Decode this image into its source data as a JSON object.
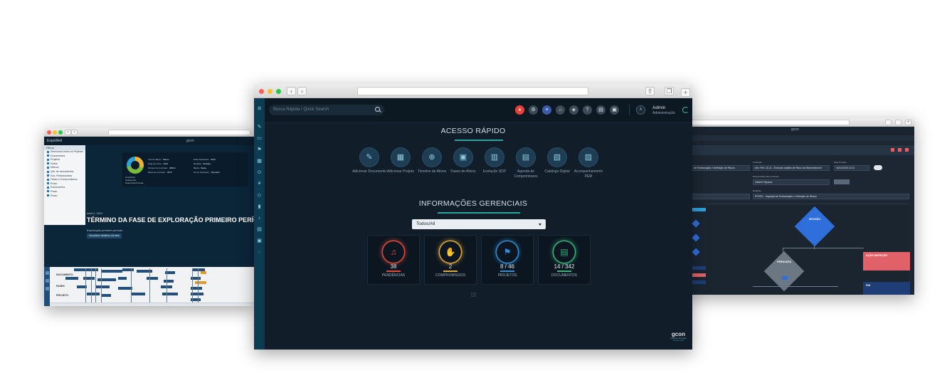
{
  "left_window": {
    "app_name": "ExpoWell",
    "logo": "gcon",
    "filter_title": "Filtros",
    "filter_items": [
      "Selecionar todos os Projetos",
      "Documentos",
      "Projetos",
      "Fases",
      "Marcos",
      "Qtd. de documentos",
      "Doc. Relacionados",
      "Fases e Compromissos",
      "Prazo",
      "Documentos",
      "Prazo",
      "Prazo"
    ],
    "info": {
      "legend": [
        "Concluída",
        "Andamento",
        "Data Final Prevista"
      ],
      "fields": [
        {
          "label": "Tipo do Bloco:",
          "value": "Marco"
        },
        {
          "label": "Data de Início:",
          "value": "2016"
        },
        {
          "label": "Número do Contrato:",
          "value": "48610"
        },
        {
          "label": "Bacia do Contrato:",
          "value": "4870"
        },
        {
          "label": "Data Assinatura:",
          "value": "2016"
        },
        {
          "label": "Rodada:",
          "value": "Rodada"
        },
        {
          "label": "Bacia:",
          "value": "Bacia"
        },
        {
          "label": "Nome Operador:",
          "value": "Operador"
        }
      ]
    },
    "event_date": "Abril 2, 2021",
    "event_title": "TÉRMINO DA FASE DE EXPLORAÇÃO PRIMEIRO PERÍODO",
    "event_subtitle": "Exploração primeiro período",
    "details_button": "Visualizar detalhes da fase",
    "timeline_rows": [
      "DOCUMENTO",
      "FASES",
      "PROJETO"
    ]
  },
  "right_window": {
    "logo": "gcon",
    "header_strip": "…",
    "fields": [
      {
        "label": "Conteúdo",
        "value": "Ativ. Perf.-DI-11 - Executar análise de Risco de Bioinvestiment"
      },
      {
        "label": "Data Criação",
        "value": "16/11/2020 12:31"
      },
      {
        "label": "Responsável pelo processo",
        "value": "Gabriel Tayseca"
      },
      {
        "label": "Detalhes",
        "value": "PPOEX - Inspeção de Embarcação e Definição de Riscos"
      }
    ],
    "field_left": "… de Embarcação e Definição de Riscos",
    "decision_label": "DECISÃO",
    "question_label": "PERGUNTA",
    "action_label": "AÇÃO INSPEÇÃO",
    "end_label": "FIM"
  },
  "center_window": {
    "search_placeholder": "Busca Rápida / Quick Search",
    "user": {
      "name": "Admin",
      "role": "Administração",
      "initial": "A"
    },
    "quick_access_title": "ACESSO RÁPIDO",
    "quick_access": [
      {
        "label": "Adicionar Documento",
        "icon": "doc-edit-icon"
      },
      {
        "label": "Adicionar Projeto",
        "icon": "project-add-icon"
      },
      {
        "label": "Timeline de Ativos",
        "icon": "timeline-icon"
      },
      {
        "label": "Fases de Ativos",
        "icon": "phases-icon"
      },
      {
        "label": "Evolução SDP",
        "icon": "evolution-icon"
      },
      {
        "label": "Agenda de Compromissos",
        "icon": "calendar-icon"
      },
      {
        "label": "Catálogo Digital",
        "icon": "catalog-icon"
      },
      {
        "label": "Acompanhamento PEM",
        "icon": "tracking-icon"
      }
    ],
    "management_title": "INFORMAÇÕES GERENCIAIS",
    "filter_select": "Todos/All",
    "cards": [
      {
        "value": "38",
        "label": "PENDÊNCIAS",
        "icon": "bell-icon",
        "color": "#e04a3a"
      },
      {
        "value": "2",
        "label": "COMPROMISSOS",
        "icon": "handshake-icon",
        "color": "#e0a83a"
      },
      {
        "value": "8 / 46",
        "label": "PROJETOS",
        "icon": "flag-icon",
        "color": "#2f8ed6"
      },
      {
        "value": "14 / 342",
        "label": "DOCUMENTOS",
        "icon": "document-icon",
        "color": "#3ab07a"
      }
    ],
    "brand": {
      "name": "gcon",
      "powered": "Powered by Google",
      "version": "Version 2.0.0"
    }
  }
}
